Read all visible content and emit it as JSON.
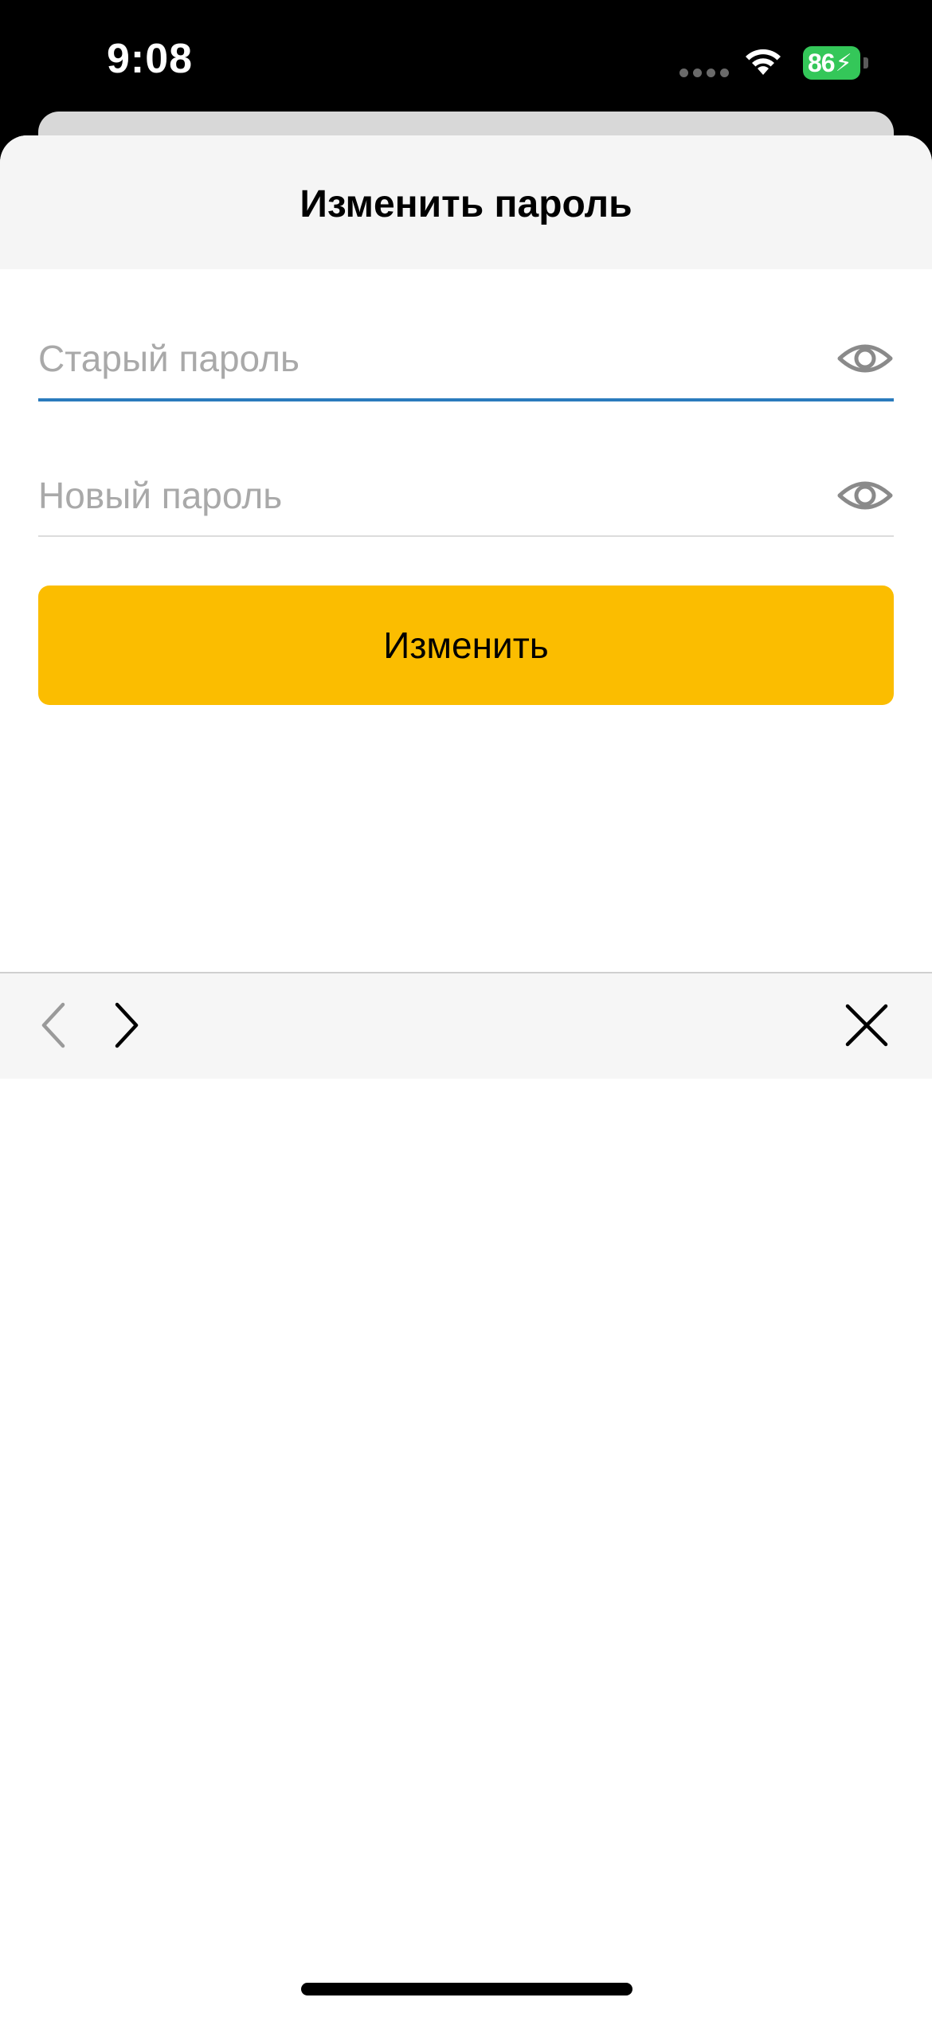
{
  "status_bar": {
    "time": "9:08",
    "battery_level": "86",
    "battery_charging": true,
    "battery_color": "#34c759"
  },
  "sheet": {
    "title": "Изменить пароль",
    "header_bg": "#f5f5f5"
  },
  "form": {
    "old_password": {
      "value": "",
      "placeholder": "Старый пароль",
      "toggle_icon": "eye-icon",
      "focused": true,
      "focus_color": "#2a7bbd"
    },
    "new_password": {
      "value": "",
      "placeholder": "Новый пароль",
      "toggle_icon": "eye-icon"
    },
    "submit_label": "Изменить",
    "submit_color": "#fbbd00"
  },
  "accessory_toolbar": {
    "prev_icon": "chevron-left-icon",
    "next_icon": "chevron-right-icon",
    "close_icon": "close-icon"
  }
}
